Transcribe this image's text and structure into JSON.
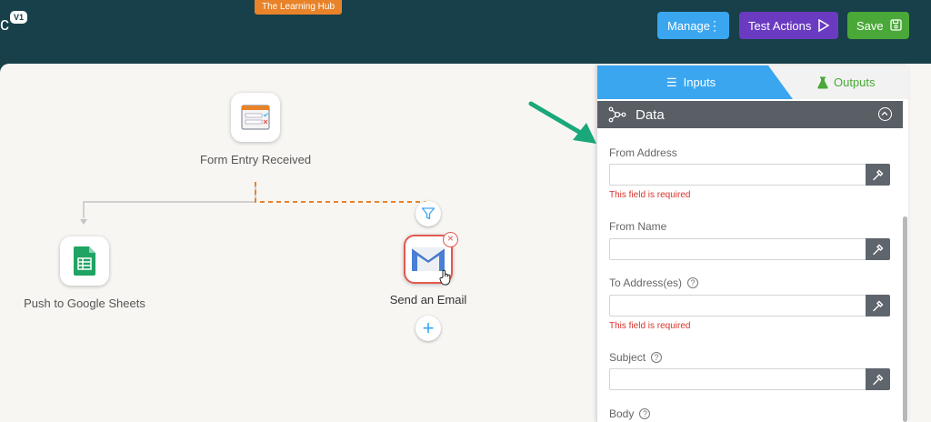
{
  "header": {
    "title_fragment": "c",
    "version_badge": "V1",
    "hub_badge": "The Learning Hub",
    "manage_label": "Manage",
    "test_actions_label": "Test Actions",
    "save_label": "Save",
    "colors": {
      "background": "#17404a",
      "manage": "#3ba6f0",
      "test": "#6a3bc0",
      "save": "#4aa838",
      "hub": "#e8832a"
    }
  },
  "canvas": {
    "nodes": [
      {
        "label": "Form Entry Received",
        "icon": "form-icon"
      },
      {
        "label": "Push to Google Sheets",
        "icon": "google-sheets-icon"
      },
      {
        "label": "Send an Email",
        "icon": "gmail-icon"
      }
    ]
  },
  "panel": {
    "tab_inputs": "Inputs",
    "tab_outputs": "Outputs",
    "section_title": "Data",
    "required_message": "This field is required",
    "fields": [
      {
        "label": "From Address",
        "value": "",
        "required_error": true
      },
      {
        "label": "From Name",
        "value": "",
        "required_error": false
      },
      {
        "label": "To Address(es)",
        "value": "",
        "required_error": true
      },
      {
        "label": "Subject",
        "value": "",
        "required_error": false
      },
      {
        "label": "Body",
        "value": "",
        "required_error": false
      }
    ]
  }
}
